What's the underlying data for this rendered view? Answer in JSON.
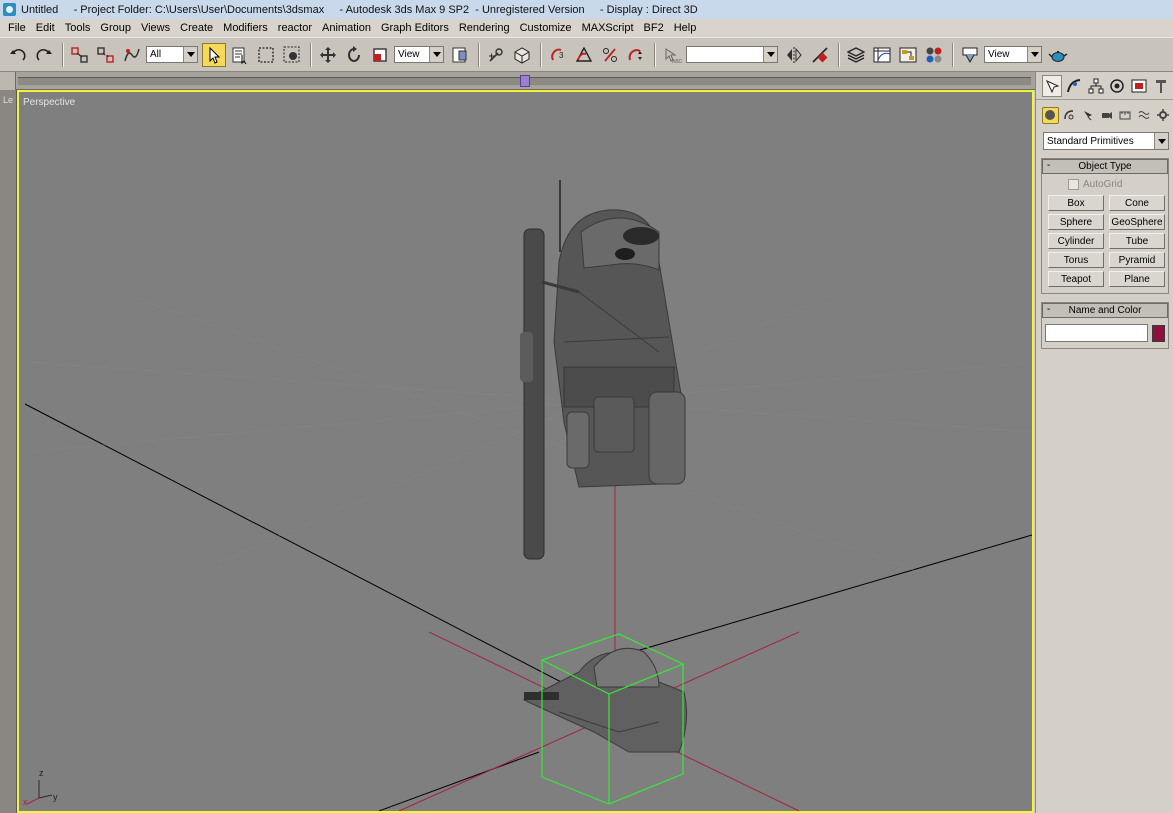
{
  "titlebar": {
    "text": "Untitled     - Project Folder: C:\\Users\\User\\Documents\\3dsmax     - Autodesk 3ds Max 9 SP2  - Unregistered Version     - Display : Direct 3D"
  },
  "menubar": {
    "items": [
      "File",
      "Edit",
      "Tools",
      "Group",
      "Views",
      "Create",
      "Modifiers",
      "reactor",
      "Animation",
      "Graph Editors",
      "Rendering",
      "Customize",
      "MAXScript",
      "BF2",
      "Help"
    ]
  },
  "toolbar": {
    "selection_filter": "All",
    "ref_coord": "View",
    "named_selection": "",
    "render_type": "View"
  },
  "viewport": {
    "label": "Perspective",
    "left_strip_label": "Le",
    "axis_x": "x",
    "axis_y": "y",
    "axis_z": "z",
    "colors": {
      "background": "#7f7f7f",
      "active_border": "#f3f33a",
      "selection_box": "#38e838",
      "grid_line": "#000000",
      "red_axis": "#a3243d"
    }
  },
  "command_panel": {
    "primitive_type": "Standard Primitives",
    "object_type_title": "Object Type",
    "autogrid_label": "AutoGrid",
    "object_buttons": [
      "Box",
      "Cone",
      "Sphere",
      "GeoSphere",
      "Cylinder",
      "Tube",
      "Torus",
      "Pyramid",
      "Teapot",
      "Plane"
    ],
    "name_color_title": "Name and Color",
    "name_value": "",
    "swatch_color": "#8e1140",
    "collapse_symbol": "-"
  }
}
